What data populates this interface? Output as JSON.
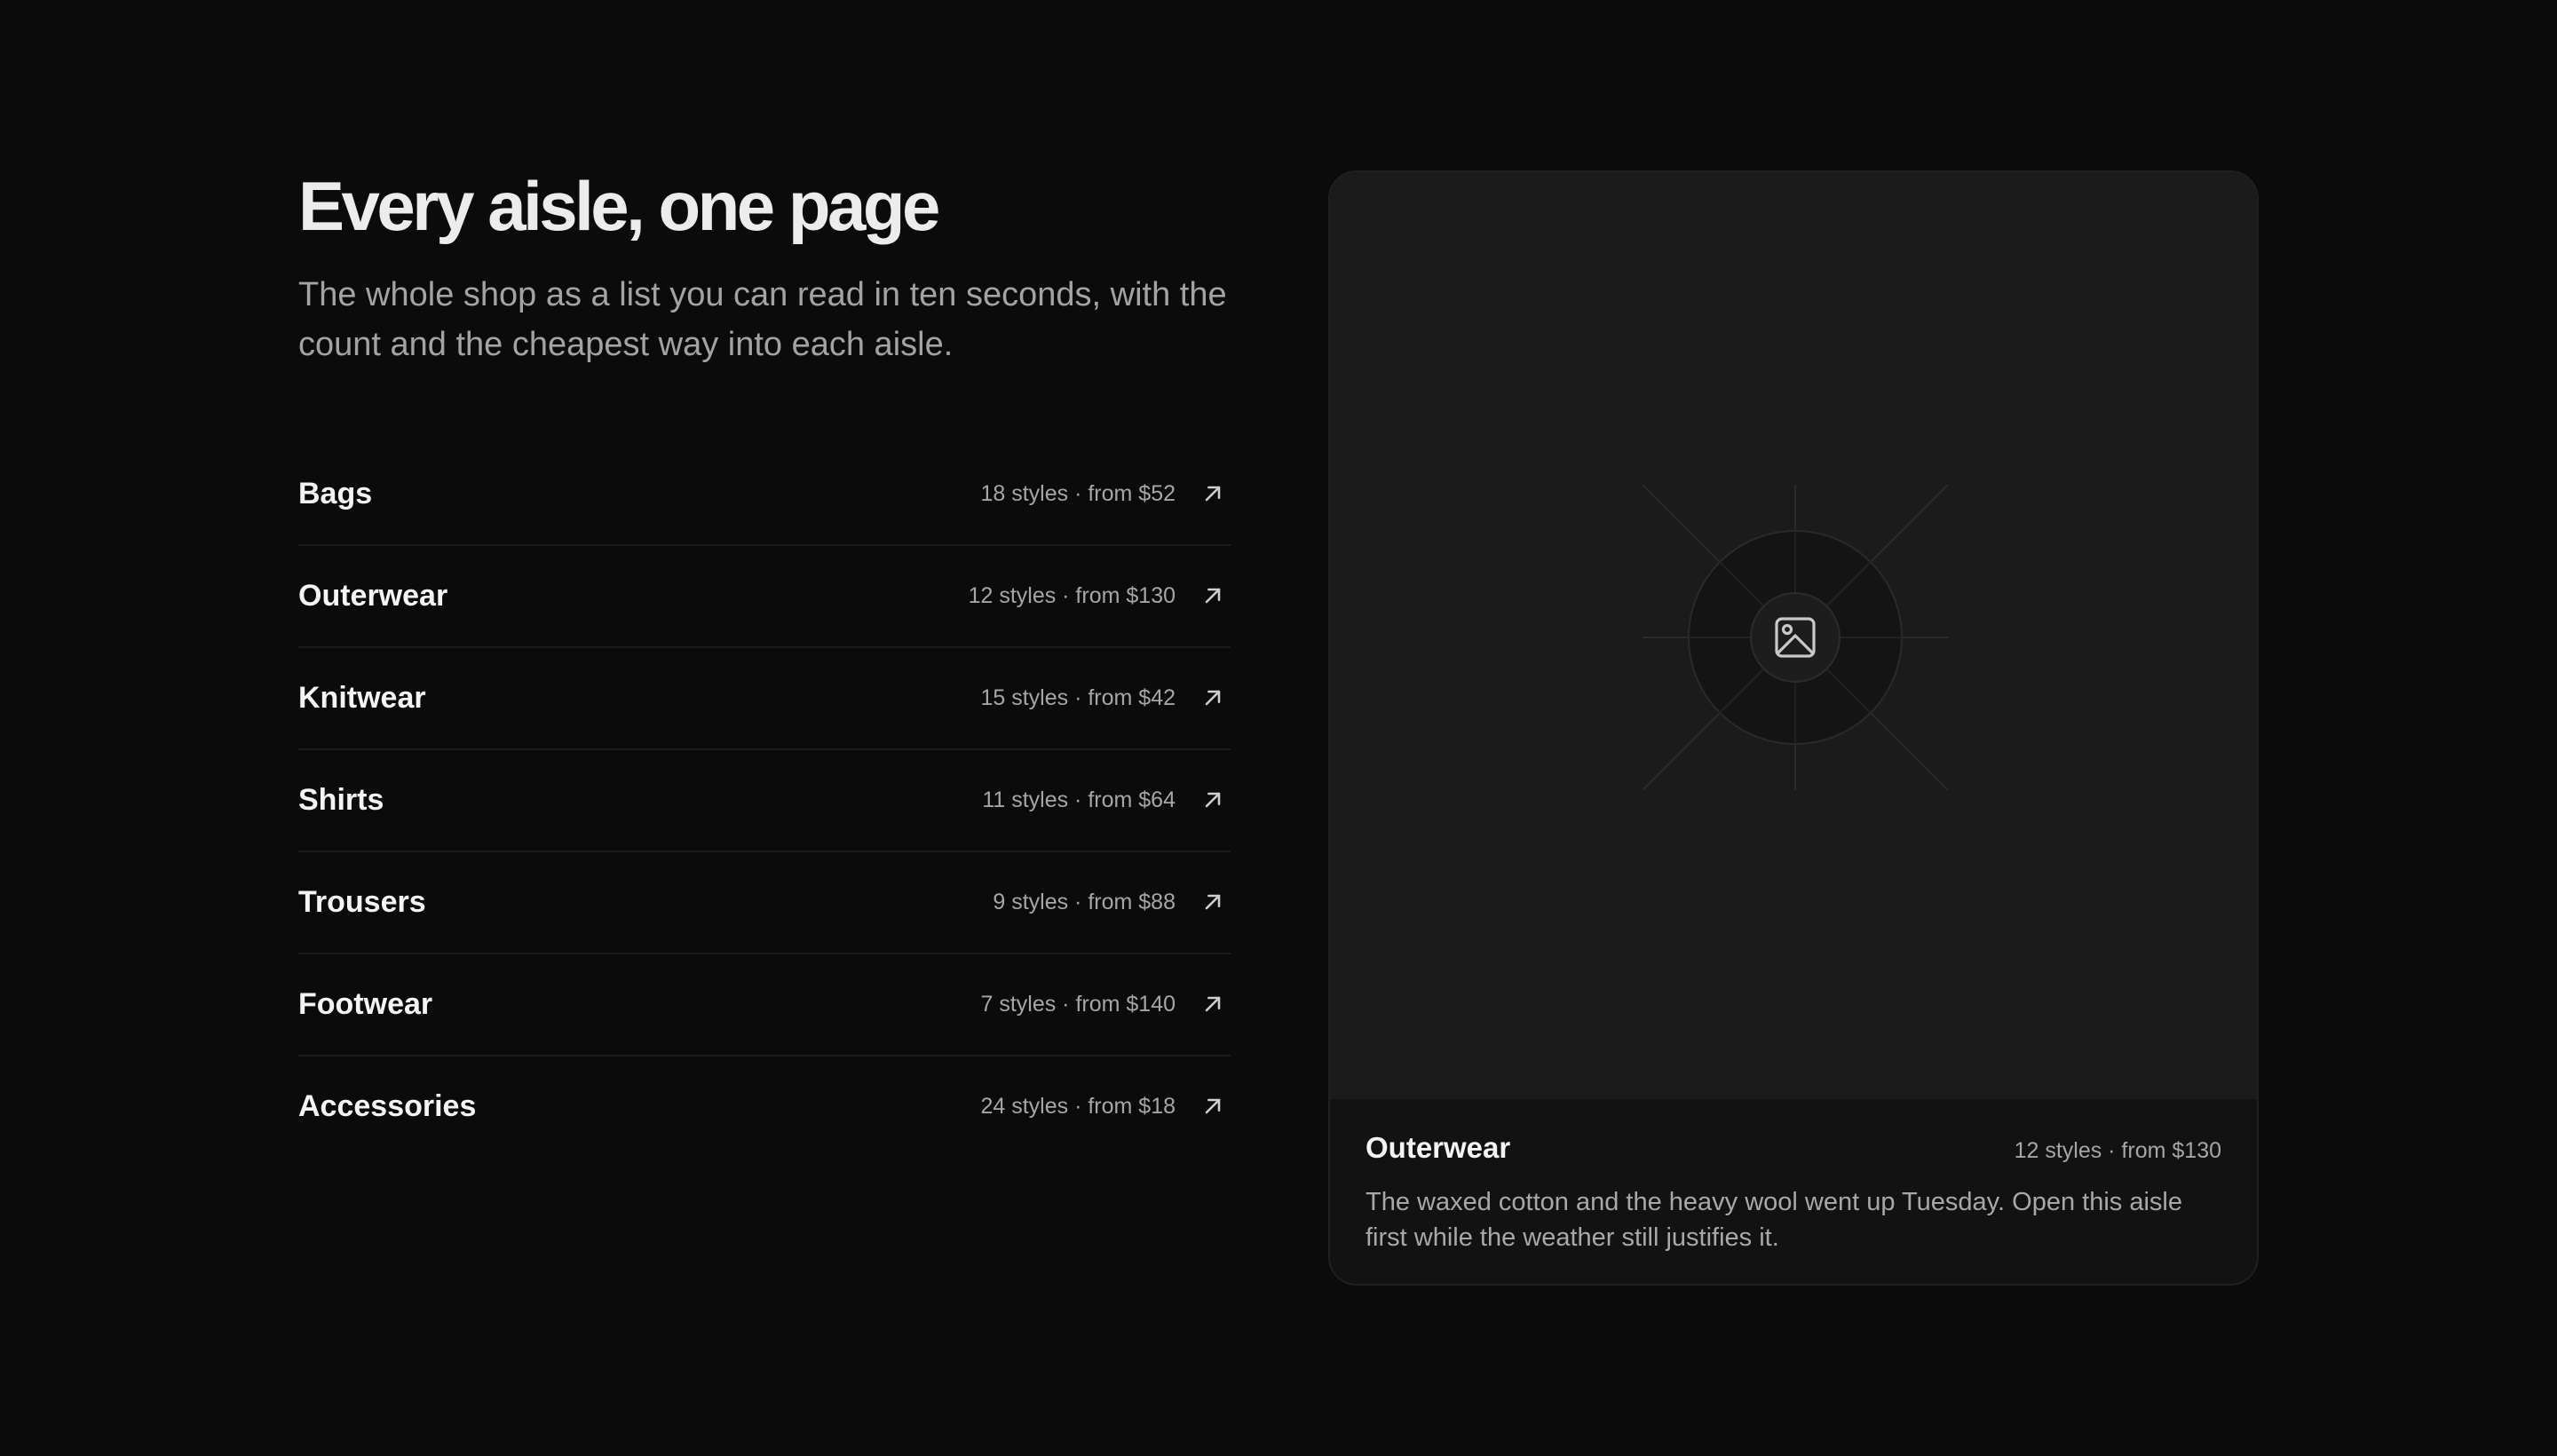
{
  "header": {
    "title": "Every aisle, one page",
    "subtitle": "The whole shop as a list you can read in ten seconds, with the count and the cheapest way into each aisle."
  },
  "aisles": [
    {
      "name": "Bags",
      "meta": "18 styles · from $52"
    },
    {
      "name": "Outerwear",
      "meta": "12 styles · from $130"
    },
    {
      "name": "Knitwear",
      "meta": "15 styles · from $42"
    },
    {
      "name": "Shirts",
      "meta": "11 styles · from $64"
    },
    {
      "name": "Trousers",
      "meta": "9 styles · from $88"
    },
    {
      "name": "Footwear",
      "meta": "7 styles · from $140"
    },
    {
      "name": "Accessories",
      "meta": "24 styles · from $18"
    }
  ],
  "preview": {
    "title": "Outerwear",
    "meta": "12 styles · from $130",
    "description": "The waxed cotton and the heavy wool went up Tuesday. Open this aisle first while the weather still justifies it.",
    "image_icon": "image-placeholder-icon"
  },
  "icons": {
    "row_arrow": "arrow-up-right-icon"
  },
  "colors": {
    "background": "#0b0b0b",
    "card": "#1a1a1a",
    "card_footer": "#121212",
    "text_primary": "#f4f4f4",
    "text_secondary": "#a6a6a6",
    "divider": "#1c1c1c"
  }
}
